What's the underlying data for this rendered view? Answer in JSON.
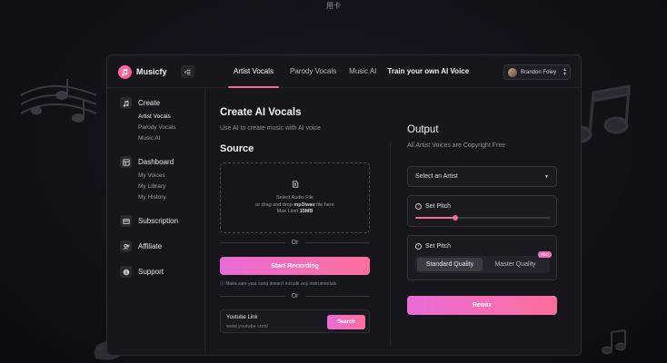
{
  "page": {
    "caption": "用卡"
  },
  "app": {
    "brand": "Musicfy"
  },
  "tabs": [
    {
      "label": "Artist Vocals",
      "active": true
    },
    {
      "label": "Parody Vocals",
      "active": false
    },
    {
      "label": "Music AI",
      "active": false
    },
    {
      "label": "Train your own AI Voice",
      "active": false
    }
  ],
  "user": {
    "name": "Brandon Foley"
  },
  "sidebar": {
    "create": {
      "label": "Create",
      "items": [
        "Artist Vocals",
        "Parody Vocals",
        "Music AI"
      ]
    },
    "dashboard": {
      "label": "Dashboard",
      "items": [
        "My Voices",
        "My Library",
        "My History"
      ]
    },
    "subscription": "Subscription",
    "affiliate": "Affiliate",
    "support": "Support"
  },
  "main": {
    "title": "Create AI Vocals",
    "subtitle": "Use AI to create music with AI voice",
    "source_title": "Source",
    "dropzone": {
      "line1": "Select Audio File",
      "line2_prefix": "or drag and drop ",
      "line2_bold": "mp3/wav",
      "line2_suffix": " file here",
      "line3_prefix": "Max Limit ",
      "line3_bold": "15MB"
    },
    "or_text": "Or",
    "record_button": "Start Recording",
    "note": "Make sure your song doesn't include any instrumentals",
    "youtube": {
      "label": "Youtube Link",
      "placeholder": "www.youtube.com/",
      "button": "Search"
    }
  },
  "output": {
    "title": "Output",
    "subtitle": "All Artist Voices are Copyright Free",
    "artist_select": "Select an Artist",
    "pitch_label": "Set Pitch",
    "pitch_value": 0.3,
    "quality_label": "Set Pitch",
    "quality_options": [
      "Standard Quality",
      "Master Quality"
    ],
    "quality_selected": "Standard Quality",
    "pro_badge": "PRO",
    "remix_button": "Remix"
  },
  "colors": {
    "accent": "#f06a9b",
    "gradient_start": "#e96bd6",
    "gradient_end": "#ff6f9c"
  }
}
